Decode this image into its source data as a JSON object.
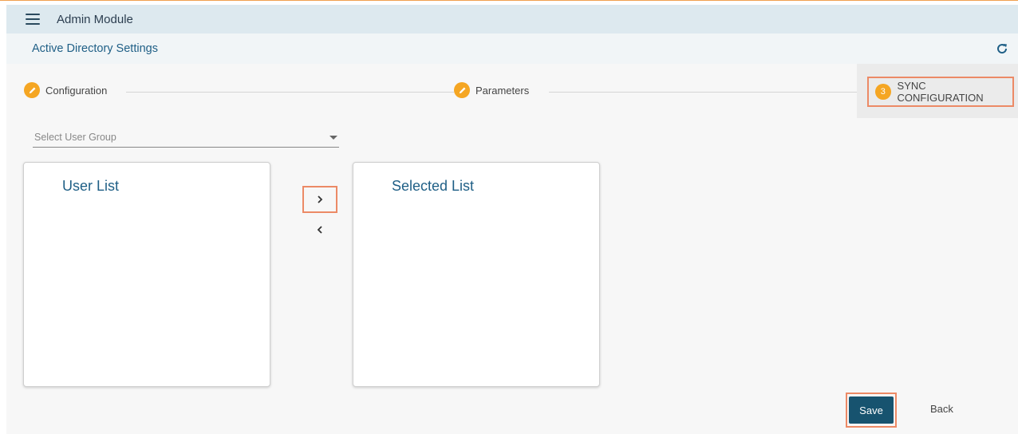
{
  "header": {
    "title": "Admin Module",
    "menu_icon": "hamburger-menu-icon"
  },
  "subheader": {
    "title": "Active Directory Settings",
    "refresh_icon": "refresh-icon"
  },
  "stepper": {
    "steps": [
      {
        "label": "Configuration",
        "icon": "pencil-icon",
        "state": "done"
      },
      {
        "label": "Parameters",
        "icon": "pencil-icon",
        "state": "done"
      },
      {
        "label": "SYNC CONFIGURATION",
        "number": "3",
        "state": "active"
      }
    ]
  },
  "form": {
    "select_placeholder": "Select User Group"
  },
  "lists": {
    "user_list_title": "User List",
    "selected_list_title": "Selected List"
  },
  "transfer": {
    "move_right_icon": "chevron-right-icon",
    "move_left_icon": "chevron-left-icon"
  },
  "actions": {
    "save_label": "Save",
    "back_label": "Back"
  },
  "colors": {
    "accent": "#f5a623",
    "primary": "#17536f",
    "link": "#1f5f86",
    "highlight": "#ec8a66"
  }
}
